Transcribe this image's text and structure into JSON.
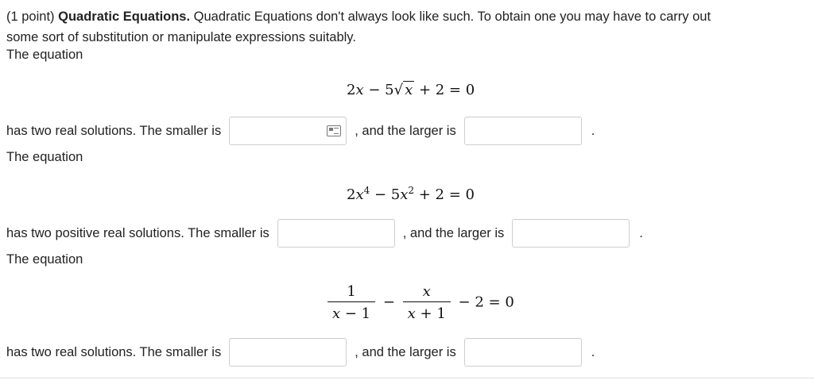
{
  "intro": {
    "points": "(1 point)",
    "title": "Quadratic Equations.",
    "text": "Quadratic Equations don't always look like such. To obtain one you may have to carry out",
    "text2": "some sort of substitution or manipulate expressions suitably."
  },
  "problems": [
    {
      "lead": "The equation",
      "equation": "2x − 5√x + 2 = 0",
      "prompt": "has two real solutions. The smaller is",
      "middle": ", and the larger is",
      "end": ".",
      "smaller_value": "",
      "larger_value": ""
    },
    {
      "lead": "The equation",
      "equation": "2x⁴ − 5x² + 2 = 0",
      "prompt": "has two positive real solutions. The smaller is",
      "middle": ", and the larger is",
      "end": ".",
      "smaller_value": "",
      "larger_value": ""
    },
    {
      "lead": "The equation",
      "equation": "1/(x − 1) − x/(x + 1) − 2 = 0",
      "prompt": "has two real solutions. The smaller is",
      "middle": ", and the larger is",
      "end": ".",
      "smaller_value": "",
      "larger_value": ""
    }
  ],
  "icons": {
    "answer_preview": "keyboard-preview-icon"
  }
}
